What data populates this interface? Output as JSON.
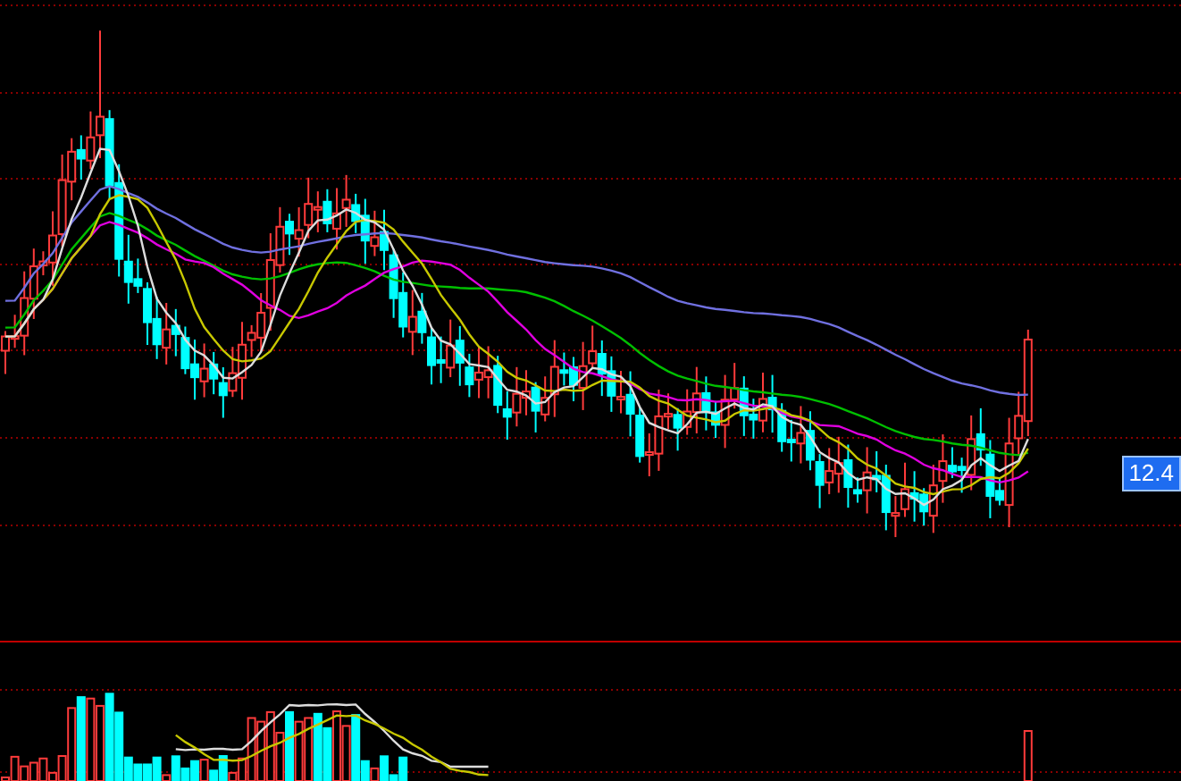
{
  "chart": {
    "price_tag": "12.4"
  }
}
